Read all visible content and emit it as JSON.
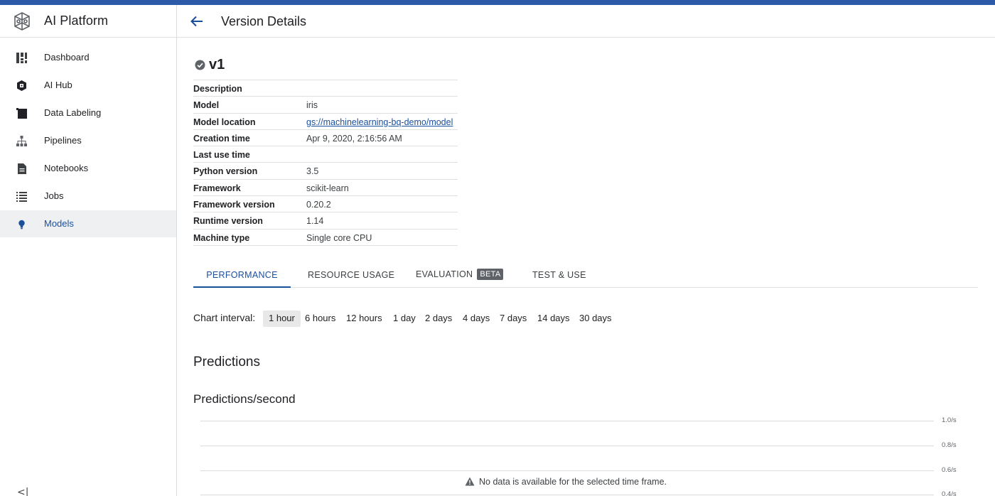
{
  "app": {
    "title": "AI Platform",
    "accent_color": "#2d5aa8",
    "brand_icon": "brain-icon"
  },
  "sidebar": {
    "items": [
      {
        "label": "Dashboard",
        "icon": "dashboard-icon"
      },
      {
        "label": "AI Hub",
        "icon": "ai-hub-icon"
      },
      {
        "label": "Data Labeling",
        "icon": "data-labeling-icon"
      },
      {
        "label": "Pipelines",
        "icon": "pipelines-icon"
      },
      {
        "label": "Notebooks",
        "icon": "notebook-icon"
      },
      {
        "label": "Jobs",
        "icon": "list-icon"
      },
      {
        "label": "Models",
        "icon": "lightbulb-icon",
        "active": true
      }
    ],
    "collapse_label": "<|"
  },
  "header": {
    "title": "Version Details",
    "back_icon": "arrow-back-icon"
  },
  "version": {
    "name": "v1",
    "status_icon": "check-circle-icon"
  },
  "details": [
    {
      "key": "Description",
      "value": ""
    },
    {
      "key": "Model",
      "value": "iris"
    },
    {
      "key": "Model location",
      "value": "gs://machinelearning-bq-demo/model",
      "link": true
    },
    {
      "key": "Creation time",
      "value": "Apr 9, 2020, 2:16:56 AM"
    },
    {
      "key": "Last use time",
      "value": ""
    },
    {
      "key": "Python version",
      "value": "3.5"
    },
    {
      "key": "Framework",
      "value": "scikit-learn"
    },
    {
      "key": "Framework version",
      "value": "0.20.2"
    },
    {
      "key": "Runtime version",
      "value": "1.14"
    },
    {
      "key": "Machine type",
      "value": "Single core CPU"
    }
  ],
  "tabs": [
    {
      "label": "PERFORMANCE",
      "active": true
    },
    {
      "label": "RESOURCE USAGE"
    },
    {
      "label": "EVALUATION",
      "badge": "BETA"
    },
    {
      "label": "TEST & USE"
    }
  ],
  "interval": {
    "label": "Chart interval:",
    "options": [
      "1 hour",
      "6 hours",
      "12 hours",
      "1 day",
      "2 days",
      "4 days",
      "7 days",
      "14 days",
      "30 days"
    ],
    "selected": "1 hour"
  },
  "predictions": {
    "section_title": "Predictions",
    "chart_title": "Predictions/second",
    "y_ticks": [
      "1.0/s",
      "0.8/s",
      "0.6/s",
      "0.4/s"
    ],
    "no_data_message": "No data is available for the selected time frame.",
    "warning_icon": "warning-icon"
  }
}
